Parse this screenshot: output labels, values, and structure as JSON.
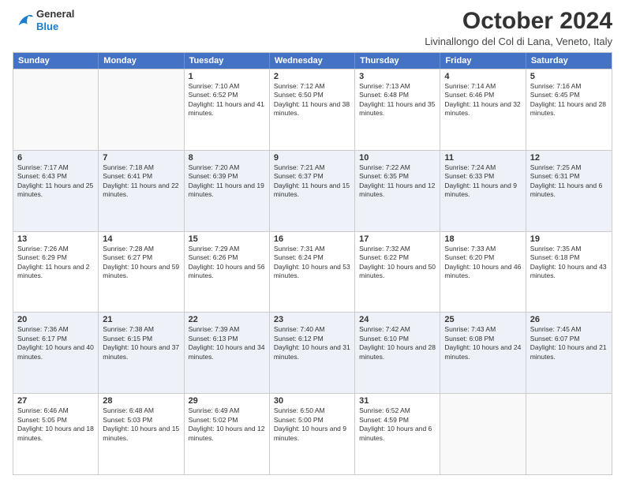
{
  "header": {
    "logo_general": "General",
    "logo_blue": "Blue",
    "month_year": "October 2024",
    "location": "Livinallongo del Col di Lana, Veneto, Italy"
  },
  "days_of_week": [
    "Sunday",
    "Monday",
    "Tuesday",
    "Wednesday",
    "Thursday",
    "Friday",
    "Saturday"
  ],
  "weeks": [
    [
      {
        "day": "",
        "detail": ""
      },
      {
        "day": "",
        "detail": ""
      },
      {
        "day": "1",
        "detail": "Sunrise: 7:10 AM\nSunset: 6:52 PM\nDaylight: 11 hours and 41 minutes."
      },
      {
        "day": "2",
        "detail": "Sunrise: 7:12 AM\nSunset: 6:50 PM\nDaylight: 11 hours and 38 minutes."
      },
      {
        "day": "3",
        "detail": "Sunrise: 7:13 AM\nSunset: 6:48 PM\nDaylight: 11 hours and 35 minutes."
      },
      {
        "day": "4",
        "detail": "Sunrise: 7:14 AM\nSunset: 6:46 PM\nDaylight: 11 hours and 32 minutes."
      },
      {
        "day": "5",
        "detail": "Sunrise: 7:16 AM\nSunset: 6:45 PM\nDaylight: 11 hours and 28 minutes."
      }
    ],
    [
      {
        "day": "6",
        "detail": "Sunrise: 7:17 AM\nSunset: 6:43 PM\nDaylight: 11 hours and 25 minutes."
      },
      {
        "day": "7",
        "detail": "Sunrise: 7:18 AM\nSunset: 6:41 PM\nDaylight: 11 hours and 22 minutes."
      },
      {
        "day": "8",
        "detail": "Sunrise: 7:20 AM\nSunset: 6:39 PM\nDaylight: 11 hours and 19 minutes."
      },
      {
        "day": "9",
        "detail": "Sunrise: 7:21 AM\nSunset: 6:37 PM\nDaylight: 11 hours and 15 minutes."
      },
      {
        "day": "10",
        "detail": "Sunrise: 7:22 AM\nSunset: 6:35 PM\nDaylight: 11 hours and 12 minutes."
      },
      {
        "day": "11",
        "detail": "Sunrise: 7:24 AM\nSunset: 6:33 PM\nDaylight: 11 hours and 9 minutes."
      },
      {
        "day": "12",
        "detail": "Sunrise: 7:25 AM\nSunset: 6:31 PM\nDaylight: 11 hours and 6 minutes."
      }
    ],
    [
      {
        "day": "13",
        "detail": "Sunrise: 7:26 AM\nSunset: 6:29 PM\nDaylight: 11 hours and 2 minutes."
      },
      {
        "day": "14",
        "detail": "Sunrise: 7:28 AM\nSunset: 6:27 PM\nDaylight: 10 hours and 59 minutes."
      },
      {
        "day": "15",
        "detail": "Sunrise: 7:29 AM\nSunset: 6:26 PM\nDaylight: 10 hours and 56 minutes."
      },
      {
        "day": "16",
        "detail": "Sunrise: 7:31 AM\nSunset: 6:24 PM\nDaylight: 10 hours and 53 minutes."
      },
      {
        "day": "17",
        "detail": "Sunrise: 7:32 AM\nSunset: 6:22 PM\nDaylight: 10 hours and 50 minutes."
      },
      {
        "day": "18",
        "detail": "Sunrise: 7:33 AM\nSunset: 6:20 PM\nDaylight: 10 hours and 46 minutes."
      },
      {
        "day": "19",
        "detail": "Sunrise: 7:35 AM\nSunset: 6:18 PM\nDaylight: 10 hours and 43 minutes."
      }
    ],
    [
      {
        "day": "20",
        "detail": "Sunrise: 7:36 AM\nSunset: 6:17 PM\nDaylight: 10 hours and 40 minutes."
      },
      {
        "day": "21",
        "detail": "Sunrise: 7:38 AM\nSunset: 6:15 PM\nDaylight: 10 hours and 37 minutes."
      },
      {
        "day": "22",
        "detail": "Sunrise: 7:39 AM\nSunset: 6:13 PM\nDaylight: 10 hours and 34 minutes."
      },
      {
        "day": "23",
        "detail": "Sunrise: 7:40 AM\nSunset: 6:12 PM\nDaylight: 10 hours and 31 minutes."
      },
      {
        "day": "24",
        "detail": "Sunrise: 7:42 AM\nSunset: 6:10 PM\nDaylight: 10 hours and 28 minutes."
      },
      {
        "day": "25",
        "detail": "Sunrise: 7:43 AM\nSunset: 6:08 PM\nDaylight: 10 hours and 24 minutes."
      },
      {
        "day": "26",
        "detail": "Sunrise: 7:45 AM\nSunset: 6:07 PM\nDaylight: 10 hours and 21 minutes."
      }
    ],
    [
      {
        "day": "27",
        "detail": "Sunrise: 6:46 AM\nSunset: 5:05 PM\nDaylight: 10 hours and 18 minutes."
      },
      {
        "day": "28",
        "detail": "Sunrise: 6:48 AM\nSunset: 5:03 PM\nDaylight: 10 hours and 15 minutes."
      },
      {
        "day": "29",
        "detail": "Sunrise: 6:49 AM\nSunset: 5:02 PM\nDaylight: 10 hours and 12 minutes."
      },
      {
        "day": "30",
        "detail": "Sunrise: 6:50 AM\nSunset: 5:00 PM\nDaylight: 10 hours and 9 minutes."
      },
      {
        "day": "31",
        "detail": "Sunrise: 6:52 AM\nSunset: 4:59 PM\nDaylight: 10 hours and 6 minutes."
      },
      {
        "day": "",
        "detail": ""
      },
      {
        "day": "",
        "detail": ""
      }
    ]
  ]
}
